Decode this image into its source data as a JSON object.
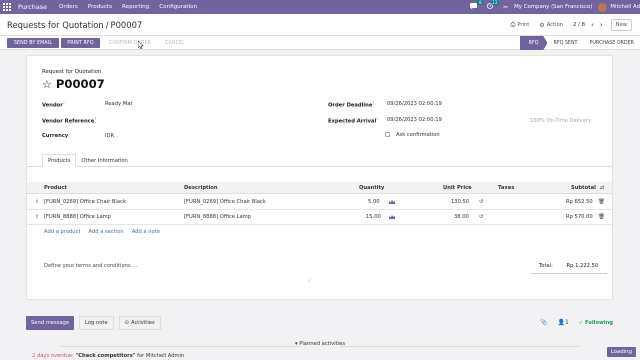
{
  "navbar": {
    "brand": "Purchase",
    "menus": [
      "Orders",
      "Products",
      "Reporting",
      "Configuration"
    ],
    "messages_count": "8",
    "activities_count": "12",
    "company": "My Company (San Francisco)",
    "user": "Mitchell Ad",
    "color": "#71639e"
  },
  "control": {
    "breadcrumb_parent": "Requests for Quotation",
    "breadcrumb_sep": "/",
    "breadcrumb_current": "P00007",
    "print_label": "Print",
    "action_label": "Action",
    "pager": "2 / 8",
    "new_label": "New"
  },
  "actions": {
    "send_email": "SEND BY EMAIL",
    "print_rfq": "PRINT RFQ",
    "confirm_order": "CONFIRM ORDER",
    "cancel": "CANCEL"
  },
  "status": [
    "RFQ",
    "RFQ SENT",
    "PURCHASE ORDER"
  ],
  "form": {
    "subtitle": "Request for Quotation",
    "title": "P00007",
    "vendor_label": "Vendor",
    "vendor": "Ready Mat",
    "vendor_ref_label": "Vendor Reference",
    "vendor_ref": "",
    "currency_label": "Currency",
    "currency": "IDR",
    "deadline_label": "Order Deadline",
    "deadline": "09/26/2023 02:00:19",
    "expected_label": "Expected Arrival",
    "expected": "09/26/2023 02:00:19",
    "on_time": "100% On-Time Delivery",
    "ask_confirm": "Ask confirmation",
    "help_mark": "?"
  },
  "tabs": [
    "Products",
    "Other Information"
  ],
  "table": {
    "headers": [
      "Product",
      "Description",
      "Quantity",
      "Unit Price",
      "Taxes",
      "Subtotal"
    ],
    "rows": [
      {
        "product": "[FURN_0269] Office Chair Black",
        "description": "[FURN_0269] Office Chair Black",
        "quantity": "5.00",
        "unit_price": "130.50",
        "taxes": "",
        "subtotal": "Rp 652.50"
      },
      {
        "product": "[FURN_8888] Office Lamp",
        "description": "[FURN_8888] Office Lamp",
        "quantity": "15.00",
        "unit_price": "38.00",
        "taxes": "",
        "subtotal": "Rp 570.00"
      }
    ],
    "add_links": [
      "Add a product",
      "Add a section",
      "Add a note"
    ]
  },
  "terms_placeholder": "Define your terms and conditions ...",
  "total": {
    "label": "Total:",
    "value": "Rp 1,222.50"
  },
  "chatter": {
    "send_message": "Send message",
    "log_note": "Log note",
    "activities": "Activities",
    "followers": "1",
    "following": "Following",
    "planned": "Planned activities",
    "overdue_prefix": "2 days overdue:",
    "overdue_text": "\"Check competitors\"",
    "overdue_suffix": "for Mitchell Admin"
  },
  "loading": "Loading"
}
